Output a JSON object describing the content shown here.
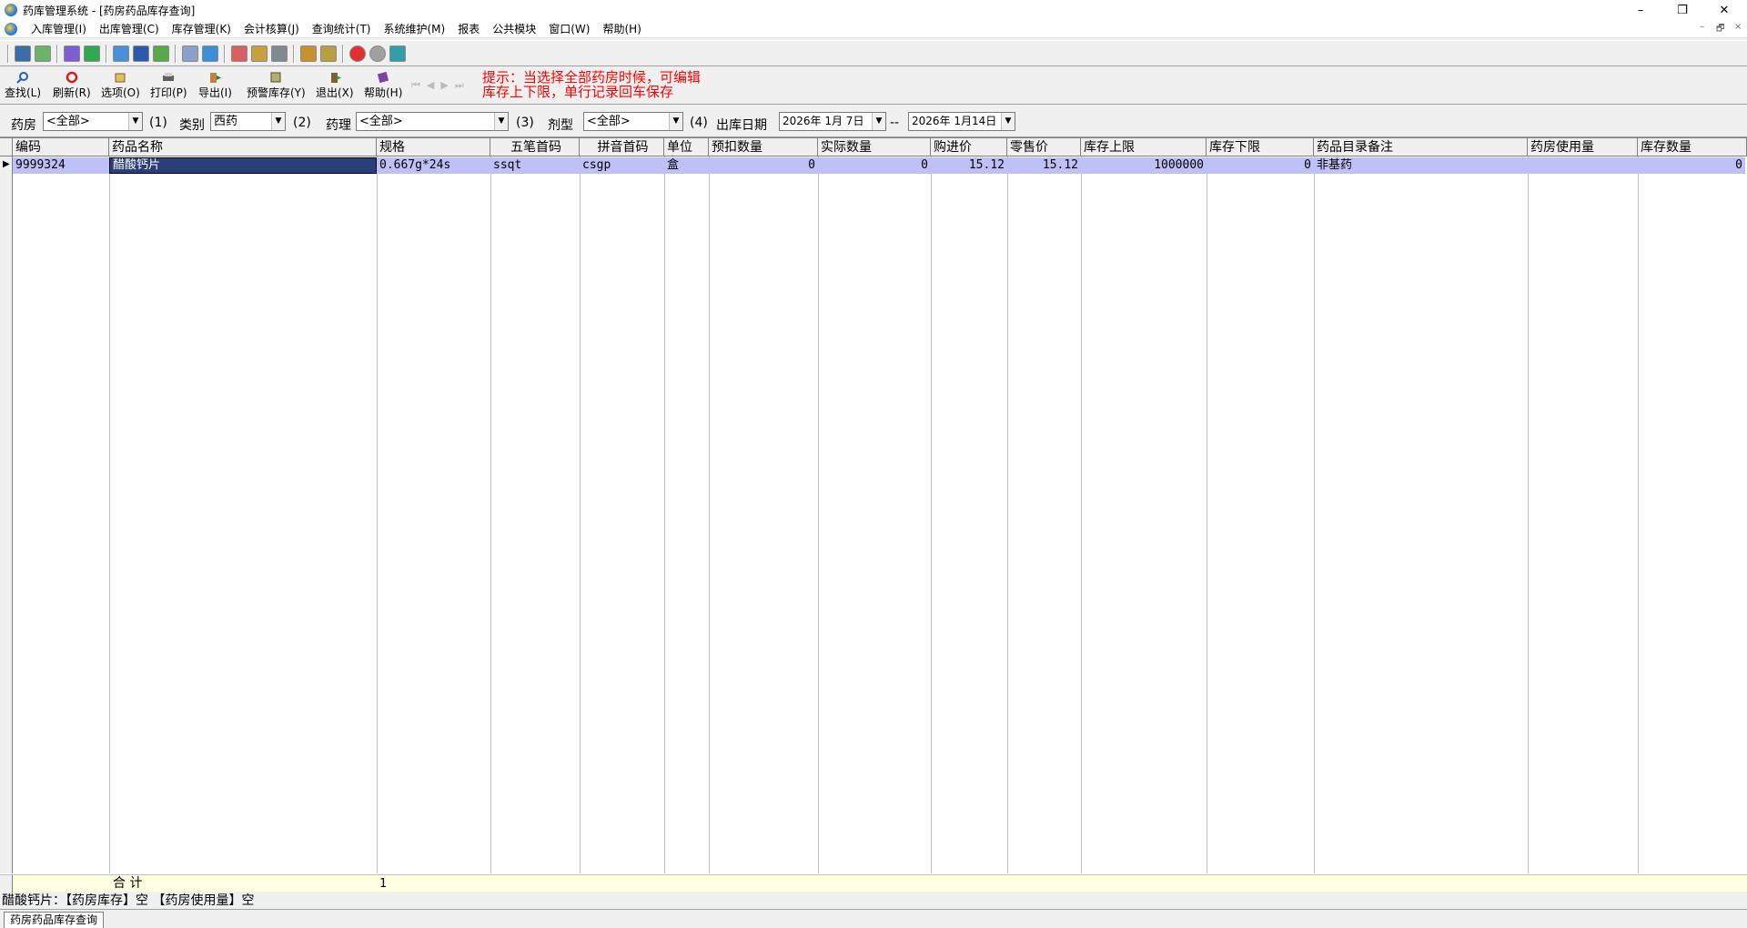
{
  "window": {
    "title": "药库管理系统 - [药房药品库存查询]",
    "minimize": "–",
    "restore": "❐",
    "close": "✕"
  },
  "menu": [
    "入库管理(I)",
    "出库管理(C)",
    "库存管理(K)",
    "会计核算(J)",
    "查询统计(T)",
    "系统维护(M)",
    "报表",
    "公共模块",
    "窗口(W)",
    "帮助(H)"
  ],
  "mdi_controls": {
    "min": "–",
    "restore": "🗗",
    "close": "×"
  },
  "toolbar_icons": [
    "login-icon",
    "refresh-doc-icon",
    "edit-doc-icon",
    "check-icon",
    "clipboard-icon",
    "image-window-icon",
    "calculator-icon",
    "list-icon",
    "table-icon",
    "grid-report-icon",
    "chart-icon",
    "magnifier-icon",
    "printer-icon",
    "thermometer-icon",
    "stop-icon",
    "cloud-icon",
    "exit-icon"
  ],
  "buttons": [
    {
      "id": "search",
      "label": "查找(L)",
      "icon": "magnifier-icon"
    },
    {
      "id": "refresh",
      "label": "刷新(R)",
      "icon": "refresh-icon"
    },
    {
      "id": "options",
      "label": "选项(O)",
      "icon": "options-icon"
    },
    {
      "id": "print",
      "label": "打印(P)",
      "icon": "printer-icon"
    },
    {
      "id": "export",
      "label": "导出(I)",
      "icon": "export-icon"
    },
    {
      "id": "warn",
      "label": "预警库存(Y)",
      "icon": "warning-stock-icon"
    },
    {
      "id": "exit",
      "label": "退出(X)",
      "icon": "exit-icon"
    },
    {
      "id": "help",
      "label": "帮助(H)",
      "icon": "book-icon"
    }
  ],
  "nav_glyphs": "⏮◀▶⏭",
  "hint_lines": [
    "提示：当选择全部药房时候，可编辑",
    "库存上下限，单行记录回车保存"
  ],
  "filters": {
    "pharmacy_label": "药房",
    "pharmacy_value": "<全部>",
    "n1": "(1)",
    "category_label": "类别",
    "category_value": "西药",
    "n2": "(2)",
    "pharmacology_label": "药理",
    "pharmacology_value": "<全部>",
    "n3": "(3)",
    "form_label": "剂型",
    "form_value": "<全部>",
    "n4": "(4)",
    "date_label": "出库日期",
    "date_from": "2026年 1月 7日",
    "date_sep": "--",
    "date_to": "2026年 1月14日"
  },
  "columns": [
    "编码",
    "药品名称",
    "规格",
    "五笔首码",
    "拼音首码",
    "单位",
    "预扣数量",
    "实际数量",
    "购进价",
    "零售价",
    "库存上限",
    "库存下限",
    "药品目录备注",
    "药房使用量",
    "库存数量"
  ],
  "rows": [
    {
      "code": "9999324",
      "name": "醋酸钙片",
      "spec": "0.667g*24s",
      "wubi": "ssqt",
      "pinyin": "csgp",
      "unit": "盒",
      "reserved": "0",
      "actual": "0",
      "purchase": "15.12",
      "retail": "15.12",
      "upper": "1000000",
      "lower": "0",
      "note": "非基药",
      "usage": "",
      "stock": "0"
    }
  ],
  "footer": {
    "label": "合  计",
    "count": "1"
  },
  "status_text": "醋酸钙片：【药房库存】空 【药房使用量】空",
  "mdi_tab": "药房药品库存查询"
}
